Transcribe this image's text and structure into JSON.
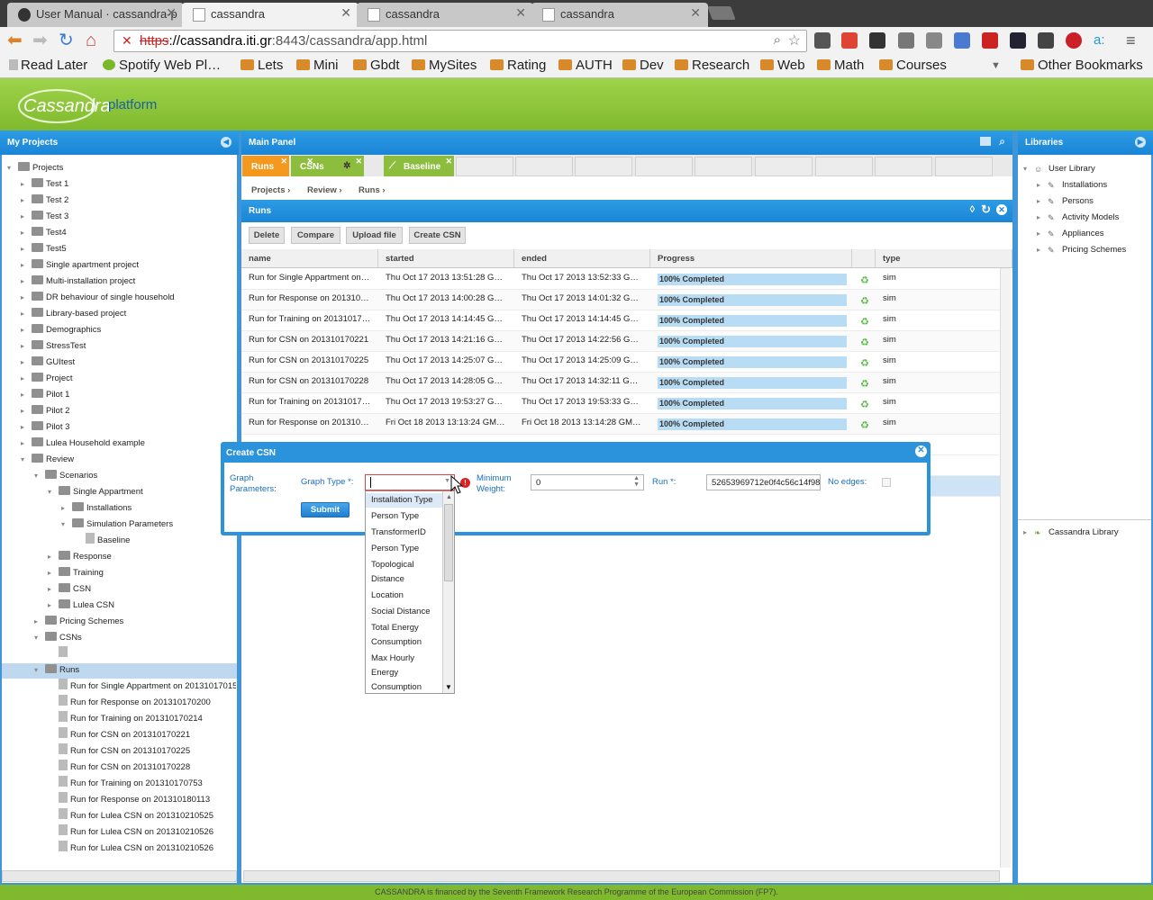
{
  "browser": {
    "tabs": [
      {
        "title": "User Manual · cassandra-p",
        "icon": "github-icon"
      },
      {
        "title": "cassandra",
        "icon": "page-icon"
      },
      {
        "title": "cassandra",
        "icon": "page-icon"
      },
      {
        "title": "cassandra",
        "icon": "page-icon"
      }
    ],
    "url_scheme": "https",
    "url_host": "://cassandra.iti.gr",
    "url_rest": ":8443/cassandra/app.html",
    "bookmarks": [
      "Read Later",
      "Spotify Web Pl…",
      "Lets",
      "Mini",
      "Gbdt",
      "MySites",
      "Rating",
      "AUTH",
      "Dev",
      "Research",
      "Web",
      "Math",
      "Courses",
      "Other Bookmarks"
    ]
  },
  "app": {
    "logo": "Cassandra",
    "subtitle": "platform"
  },
  "left_panel": {
    "title": "My Projects",
    "tree": [
      "Projects",
      "Test 1",
      "Test 2",
      "Test 3",
      "Test4",
      "Test5",
      "Single apartment project",
      "Multi-installation project",
      "DR behaviour of single household",
      "Library-based project",
      "Demographics",
      "StressTest",
      "GUItest",
      "Project",
      "Pilot 1",
      "Pilot 2",
      "Pilot 3",
      "Lulea Household example",
      "Review",
      "Scenarios",
      "Single Appartment",
      "Installations",
      "Simulation Parameters",
      "Baseline",
      "Response",
      "Training",
      "CSN",
      "Lulea CSN",
      "Pricing Schemes",
      "CSNs",
      "",
      "Runs",
      "Run for Single Appartment on 20131017015",
      "Run for Response on 201310170200",
      "Run for Training on 201310170214",
      "Run for CSN on 201310170221",
      "Run for CSN on 201310170225",
      "Run for CSN on 201310170228",
      "Run for Training on 201310170753",
      "Run for Response on 201310180113",
      "Run for Lulea CSN on 201310210525",
      "Run for Lulea CSN on 201310210526",
      "Run for Lulea CSN on 201310210526"
    ]
  },
  "main_panel": {
    "title": "Main Panel",
    "tabs": [
      "Runs",
      "CSNs",
      "Baseline"
    ],
    "breadcrumb": [
      "Projects ›",
      "Review ›",
      "Runs ›"
    ],
    "section_title": "Runs",
    "toolbar": [
      "Delete",
      "Compare",
      "Upload file",
      "Create CSN"
    ],
    "columns": [
      "name",
      "started",
      "ended",
      "Progress",
      "type"
    ],
    "rows": [
      [
        "Run for Single Appartment on…",
        "Thu Oct 17 2013 13:51:28 G…",
        "Thu Oct 17 2013 13:52:33 G…",
        "100% Completed",
        "sim"
      ],
      [
        "Run for Response on 201310…",
        "Thu Oct 17 2013 14:00:28 G…",
        "Thu Oct 17 2013 14:01:32 G…",
        "100% Completed",
        "sim"
      ],
      [
        "Run for Training on 20131017…",
        "Thu Oct 17 2013 14:14:45 G…",
        "Thu Oct 17 2013 14:14:45 G…",
        "100% Completed",
        "sim"
      ],
      [
        "Run for CSN on 201310170221",
        "Thu Oct 17 2013 14:21:16 G…",
        "Thu Oct 17 2013 14:22:56 G…",
        "100% Completed",
        "sim"
      ],
      [
        "Run for CSN on 201310170225",
        "Thu Oct 17 2013 14:25:07 G…",
        "Thu Oct 17 2013 14:25:09 G…",
        "100% Completed",
        "sim"
      ],
      [
        "Run for CSN on 201310170228",
        "Thu Oct 17 2013 14:28:05 G…",
        "Thu Oct 17 2013 14:32:11 G…",
        "100% Completed",
        "sim"
      ],
      [
        "Run for Training on 20131017…",
        "Thu Oct 17 2013 19:53:27 G…",
        "Thu Oct 17 2013 19:53:33 G…",
        "100% Completed",
        "sim"
      ],
      [
        "Run for Response on 201310…",
        "Fri Oct 18 2013 13:13:24 GM…",
        "Fri Oct 18 2013 13:14:28 GM…",
        "100% Completed",
        "sim"
      ]
    ]
  },
  "right_panel": {
    "title": "Libraries",
    "tree": [
      "User Library",
      "Installations",
      "Persons",
      "Activity Models",
      "Appliances",
      "Pricing Schemes"
    ],
    "bottom_tree": [
      "Cassandra Library"
    ]
  },
  "dialog": {
    "title": "Create CSN",
    "graph_params_label": "Graph Parameters:",
    "graph_type_label": "Graph Type *:",
    "graph_type_value": "",
    "min_weight_label": "Minimum Weight:",
    "min_weight_value": "0",
    "run_label": "Run *:",
    "run_value": "52653969712e0f4c56c14f98",
    "no_edges_label": "No edges:",
    "submit_label": "Submit",
    "options": [
      "Installation Type",
      "Person Type",
      "TransformerID",
      "Person Type",
      "Topological",
      "Distance",
      "Location",
      "Social Distance",
      "Total Energy",
      "Consumption",
      "Max Hourly",
      "Energy",
      "Consumption"
    ]
  },
  "footer": "CASSANDRA is financed by the Seventh Framework Research Programme of the European Commission (FP7)."
}
